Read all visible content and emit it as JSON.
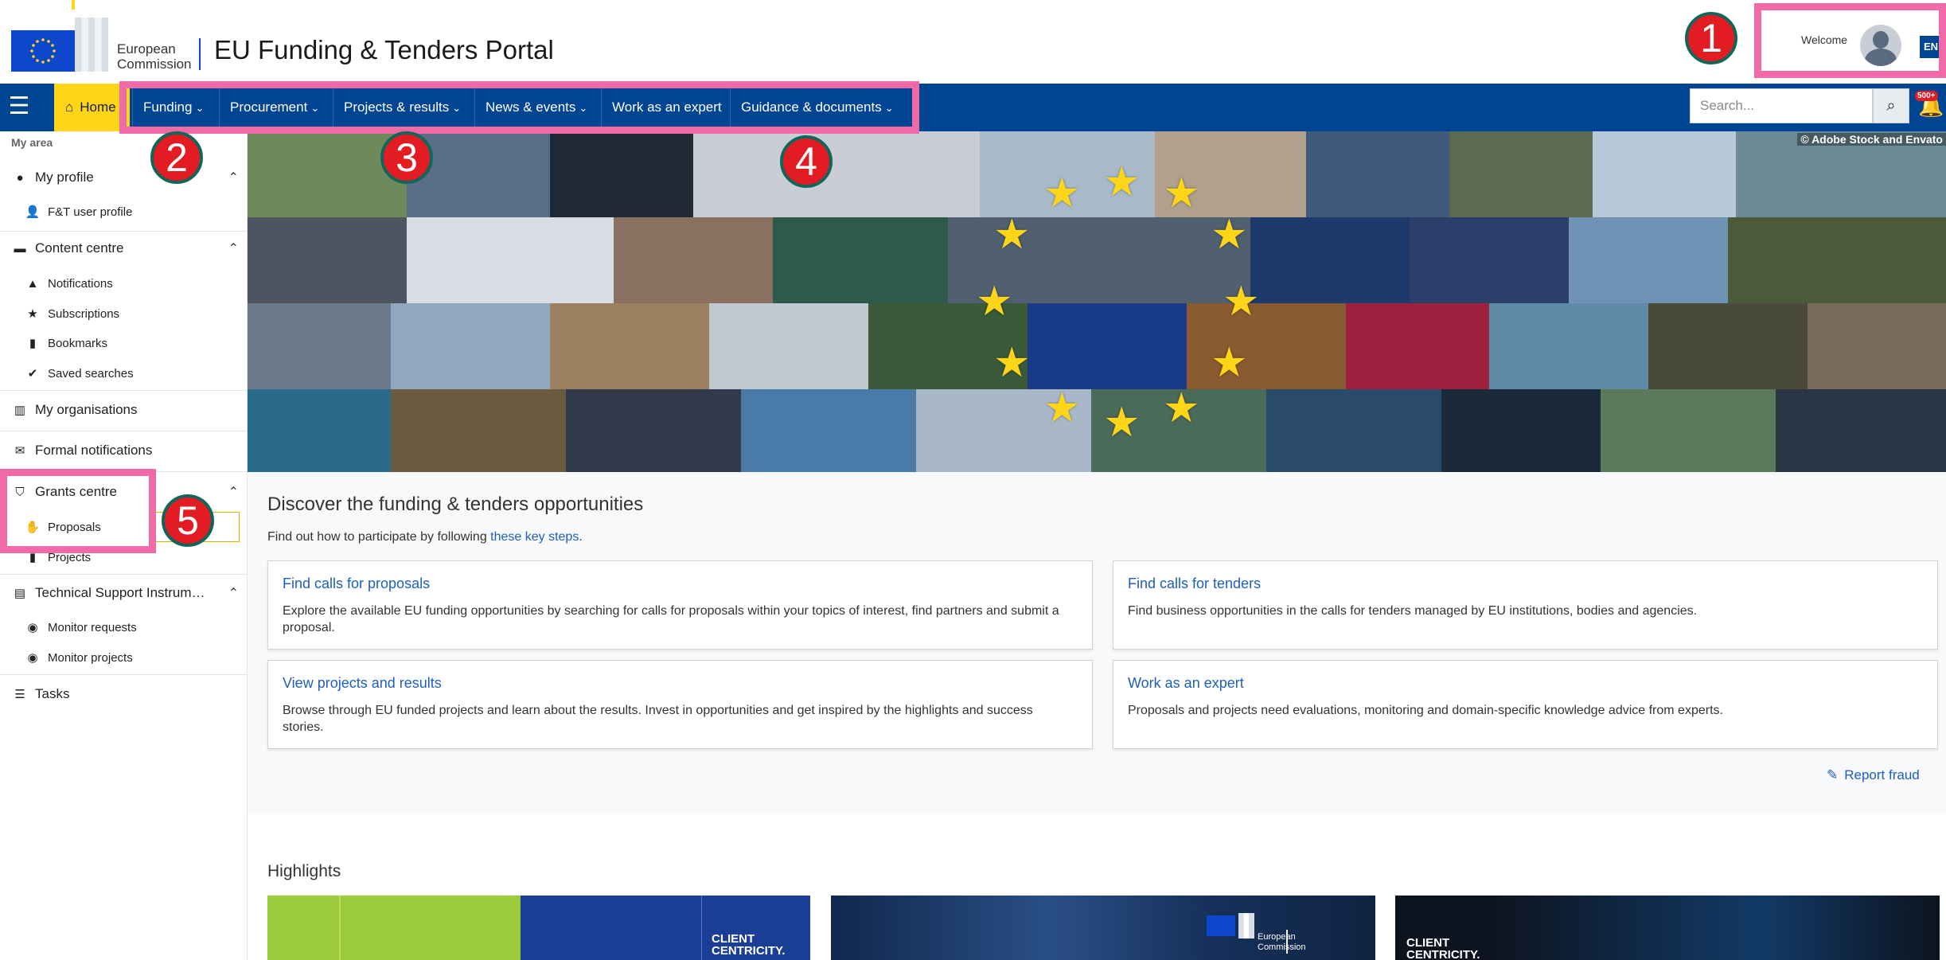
{
  "header": {
    "logo_line1": "European",
    "logo_line2": "Commission",
    "portal_title": "EU Funding & Tenders Portal",
    "welcome": "Welcome",
    "language": "EN"
  },
  "annotations": [
    "1",
    "2",
    "3",
    "4",
    "5"
  ],
  "nav": {
    "home": "Home",
    "items": [
      "Funding",
      "Procurement",
      "Projects & results",
      "News & events",
      "Work as an expert",
      "Guidance & documents"
    ],
    "search_placeholder": "Search...",
    "notifications_count": "500+"
  },
  "sidebar": {
    "section_label": "My area",
    "my_profile": "My profile",
    "ft_user_profile": "F&T user profile",
    "content_centre": "Content centre",
    "notifications": "Notifications",
    "subscriptions": "Subscriptions",
    "bookmarks": "Bookmarks",
    "saved_searches": "Saved searches",
    "my_organisations": "My organisations",
    "formal_notifications": "Formal notifications",
    "grants_centre": "Grants centre",
    "proposals": "Proposals",
    "projects": "Projects",
    "tsi": "Technical Support Instrum…",
    "monitor_requests": "Monitor requests",
    "monitor_projects": "Monitor projects",
    "tasks": "Tasks"
  },
  "hero": {
    "credit": "© Adobe Stock and Envato"
  },
  "main": {
    "title": "Discover the funding & tenders opportunities",
    "subtitle_prefix": "Find out how to participate by following ",
    "subtitle_link": "these key steps",
    "subtitle_suffix": ".",
    "cards": [
      {
        "title": "Find calls for proposals",
        "desc": "Explore the available EU funding opportunities by searching for calls for proposals within your topics of interest, find partners and submit a proposal."
      },
      {
        "title": "Find calls for tenders",
        "desc": "Find business opportunities in the calls for tenders managed by EU institutions, bodies and agencies."
      },
      {
        "title": "View projects and results",
        "desc": "Browse through EU funded projects and learn about the results. Invest in opportunities and get inspired by the highlights and success stories."
      },
      {
        "title": "Work as an expert",
        "desc": "Proposals and projects need evaluations, monitoring and domain-specific knowledge advice from experts."
      }
    ],
    "report_fraud": "Report fraud",
    "highlights": "Highlights",
    "client_line1": "CLIENT",
    "client_line2": "CENTRICITY.",
    "hl_logo_line1": "European",
    "hl_logo_line2": "Commission"
  }
}
